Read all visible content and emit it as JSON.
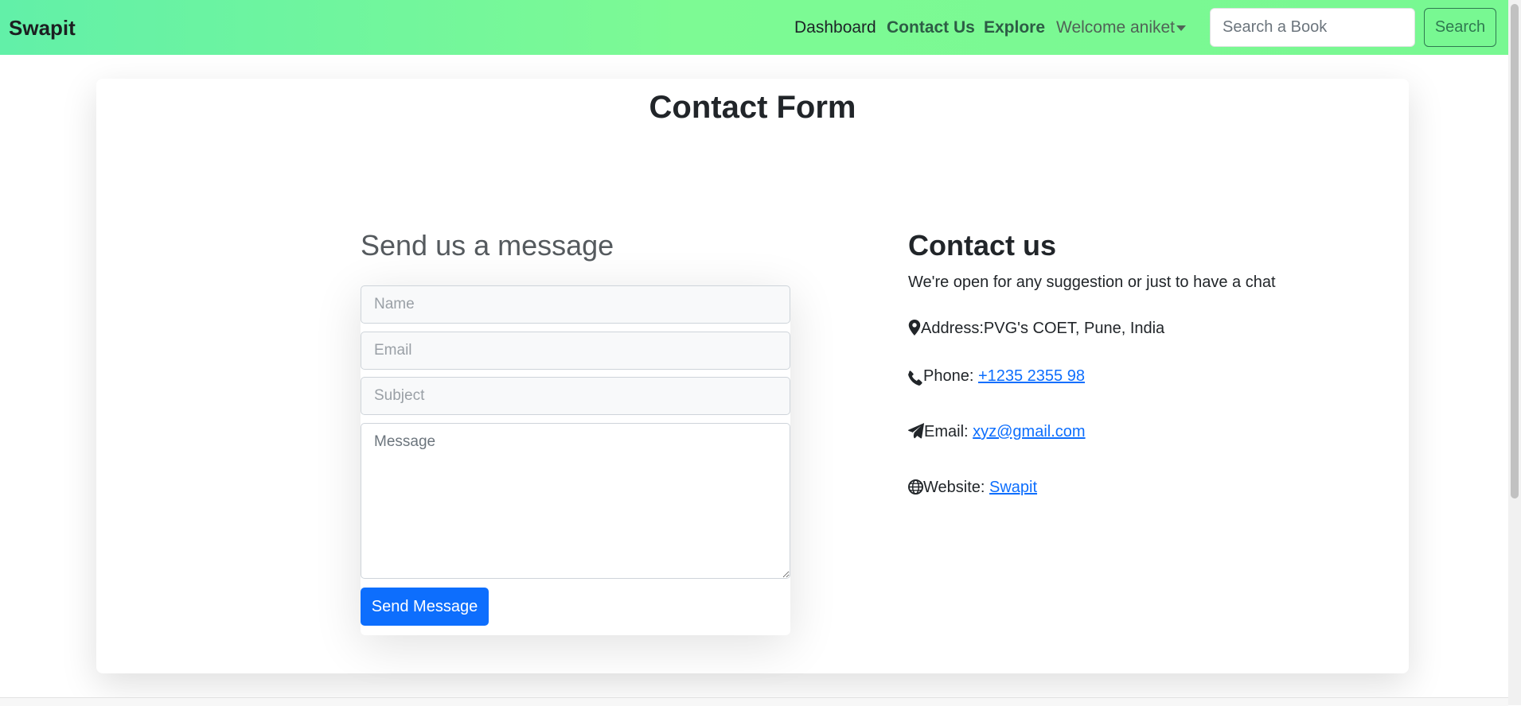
{
  "navbar": {
    "brand": "Swapit",
    "links": {
      "dashboard": "Dashboard",
      "contact": "Contact Us",
      "explore": "Explore",
      "welcome": "Welcome aniket"
    },
    "search_placeholder": "Search a Book",
    "search_button": "Search",
    "gradient_colors": [
      "#62f0a8",
      "#7dfa94"
    ]
  },
  "page": {
    "title": "Contact Form"
  },
  "form": {
    "heading": "Send us a message",
    "name_placeholder": "Name",
    "email_placeholder": "Email",
    "subject_placeholder": "Subject",
    "message_placeholder": "Message",
    "submit_label": "Send Message",
    "submit_color": "#0d6efd"
  },
  "contact": {
    "heading": "Contact us",
    "subtitle": "We're open for any suggestion or just to have a chat",
    "address_label": "Address:PVG's COET, Pune, India",
    "address_icon": "map-pin-icon",
    "phone_label": "Phone: ",
    "phone_value": "+1235 2355 98",
    "phone_icon": "phone-icon",
    "email_label": "Email: ",
    "email_value": "xyz@gmail.com",
    "email_icon": "paper-plane-icon",
    "website_label": "Website: ",
    "website_value": "Swapit",
    "website_icon": "globe-icon",
    "link_color": "#0d6efd"
  }
}
